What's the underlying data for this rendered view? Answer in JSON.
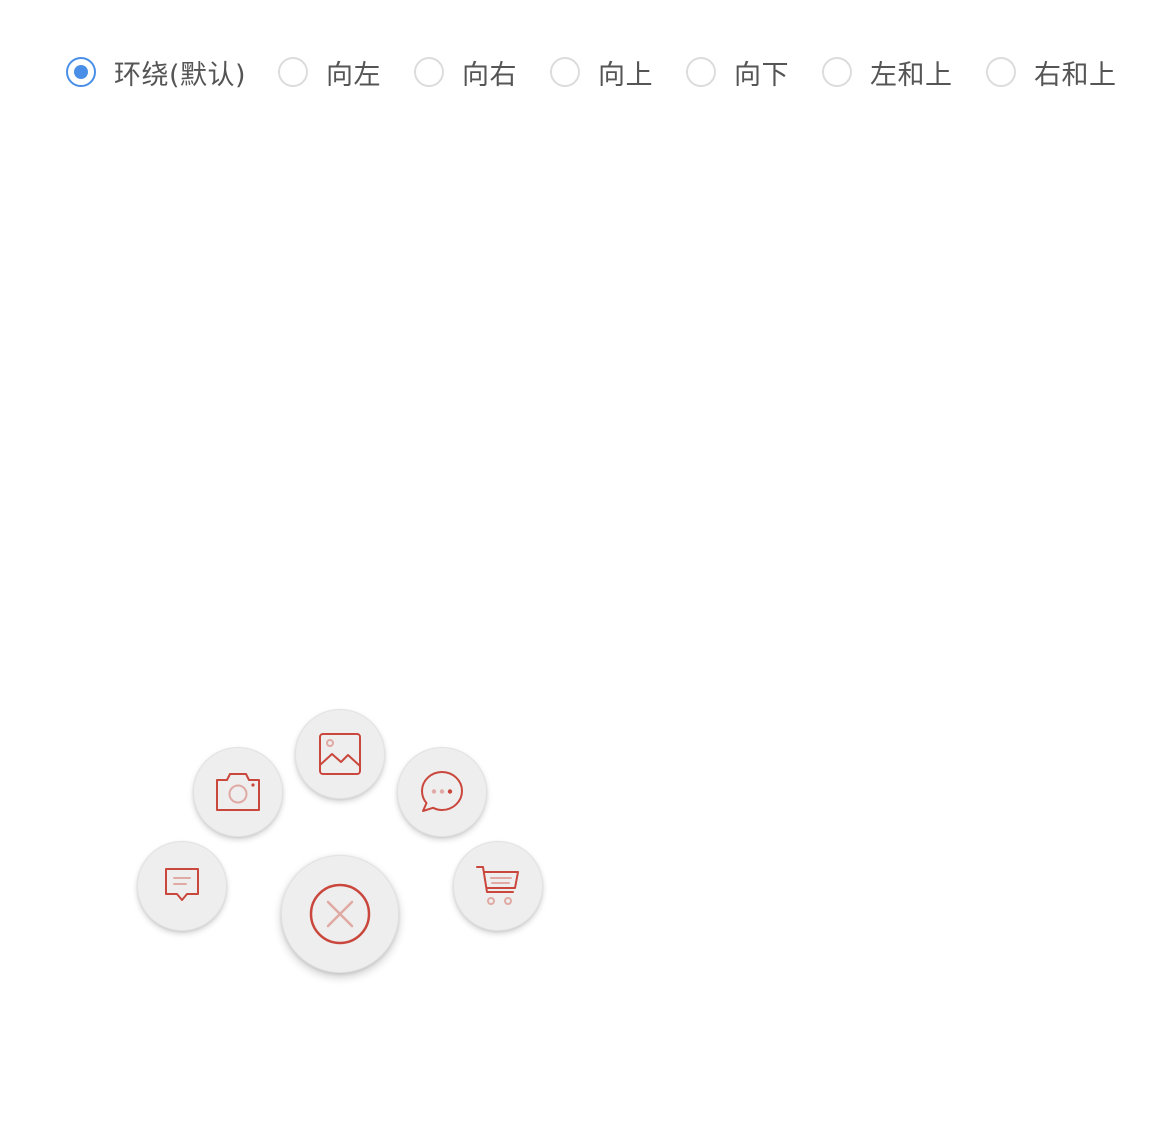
{
  "direction_selector": {
    "options": [
      {
        "label": "环绕(默认)",
        "selected": true
      },
      {
        "label": "向左",
        "selected": false
      },
      {
        "label": "向右",
        "selected": false
      },
      {
        "label": "向上",
        "selected": false
      },
      {
        "label": "向下",
        "selected": false
      },
      {
        "label": "左和上",
        "selected": false
      },
      {
        "label": "右和上",
        "selected": false
      }
    ]
  },
  "fab_menu": {
    "expanded": true,
    "main_icon": "close-icon",
    "items": [
      {
        "icon": "message-icon"
      },
      {
        "icon": "camera-icon"
      },
      {
        "icon": "image-icon"
      },
      {
        "icon": "chat-bubble-icon"
      },
      {
        "icon": "cart-icon"
      }
    ]
  },
  "colors": {
    "accent": "#4a8fe7",
    "icon": "#c9473c",
    "icon_light": "#e0a9a3",
    "fab_background": "#eeeeee",
    "label_text": "#555555"
  }
}
